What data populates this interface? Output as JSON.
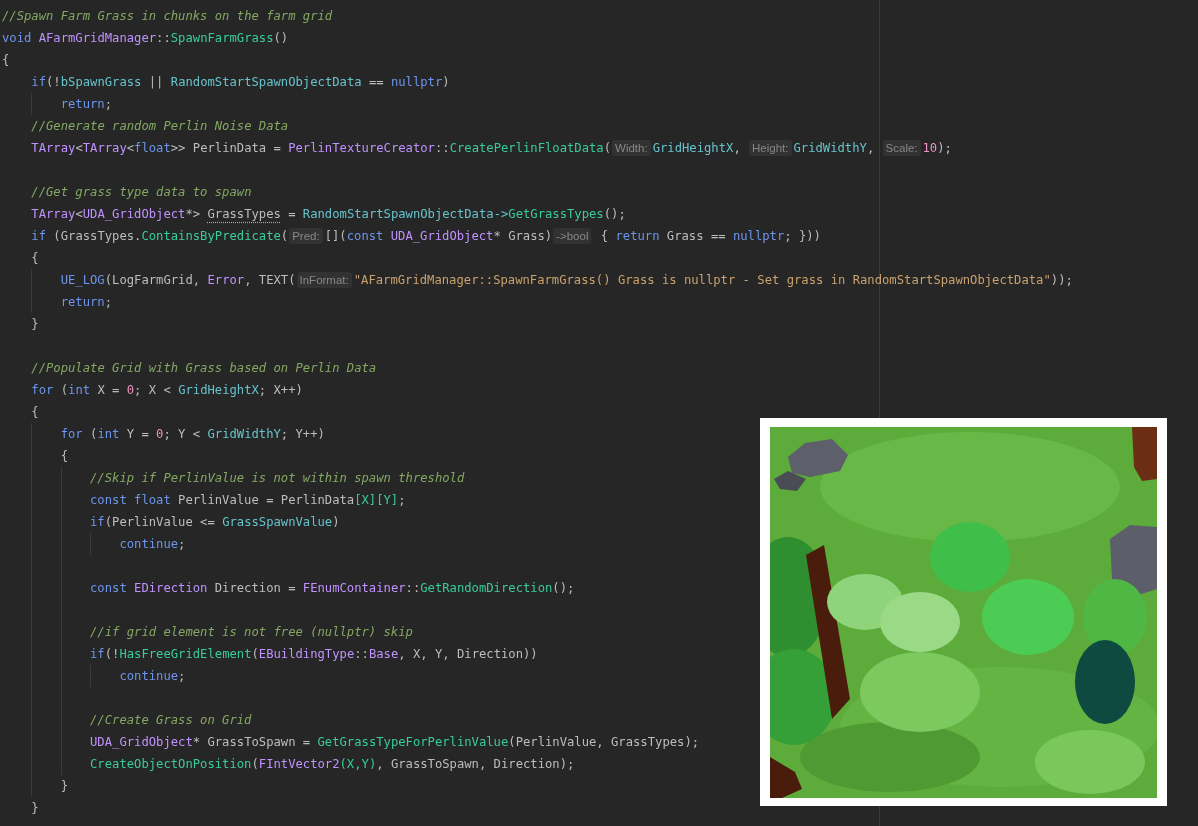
{
  "editor": {
    "lines": [
      {
        "kind": "code",
        "tokens": [
          {
            "text": "//Spawn Farm Grass in chunks on the farm grid",
            "kind": "comment"
          }
        ]
      },
      {
        "kind": "code",
        "tokens": [
          {
            "text": "void ",
            "kind": "keyword"
          },
          {
            "text": "AFarmGridManager",
            "kind": "type"
          },
          {
            "text": "::",
            "kind": "plain"
          },
          {
            "text": "SpawnFarmGrass",
            "kind": "function"
          },
          {
            "text": "()",
            "kind": "plain"
          }
        ]
      },
      {
        "kind": "code",
        "tokens": [
          {
            "text": "{",
            "kind": "plain"
          }
        ],
        "children": [
          {
            "kind": "code",
            "tokens": [
              {
                "text": "if",
                "kind": "keyword"
              },
              {
                "text": "(!",
                "kind": "plain"
              },
              {
                "text": "bSpawnGrass",
                "kind": "field"
              },
              {
                "text": " || ",
                "kind": "plain"
              },
              {
                "text": "RandomStartSpawnObjectData",
                "kind": "field"
              },
              {
                "text": " == ",
                "kind": "plain"
              },
              {
                "text": "nullptr",
                "kind": "keyword"
              },
              {
                "text": ")",
                "kind": "plain"
              }
            ],
            "children": [
              {
                "kind": "code",
                "tokens": [
                  {
                    "text": "return",
                    "kind": "keyword"
                  },
                  {
                    "text": ";",
                    "kind": "plain"
                  }
                ]
              }
            ]
          },
          {
            "kind": "code",
            "tokens": [
              {
                "text": "//Generate random Perlin Noise Data",
                "kind": "comment"
              }
            ]
          },
          {
            "kind": "code",
            "tokens": [
              {
                "text": "TArray",
                "kind": "type"
              },
              {
                "text": "<",
                "kind": "plain"
              },
              {
                "text": "TArray",
                "kind": "type"
              },
              {
                "text": "<",
                "kind": "plain"
              },
              {
                "text": "float",
                "kind": "keyword"
              },
              {
                "text": ">> PerlinData = ",
                "kind": "plain"
              },
              {
                "text": "PerlinTextureCreator",
                "kind": "type"
              },
              {
                "text": "::",
                "kind": "plain"
              },
              {
                "text": "CreatePerlinFloatData",
                "kind": "function"
              },
              {
                "text": "(",
                "kind": "plain"
              },
              {
                "text": "Width:",
                "kind": "hint"
              },
              {
                "text": "GridHeightX",
                "kind": "field"
              },
              {
                "text": ", ",
                "kind": "plain"
              },
              {
                "text": "Height:",
                "kind": "hint"
              },
              {
                "text": "GridWidthY",
                "kind": "field"
              },
              {
                "text": ", ",
                "kind": "plain"
              },
              {
                "text": "Scale:",
                "kind": "hint"
              },
              {
                "text": "10",
                "kind": "number"
              },
              {
                "text": ");",
                "kind": "plain"
              }
            ]
          },
          {
            "kind": "blank"
          },
          {
            "kind": "code",
            "tokens": [
              {
                "text": "//Get grass type data to spawn",
                "kind": "comment"
              }
            ]
          },
          {
            "kind": "code",
            "tokens": [
              {
                "text": "TArray",
                "kind": "type"
              },
              {
                "text": "<",
                "kind": "plain"
              },
              {
                "text": "UDA_GridObject",
                "kind": "type"
              },
              {
                "text": "*> ",
                "kind": "plain"
              },
              {
                "text": "GrassTypes",
                "kind": "flagged"
              },
              {
                "text": " = ",
                "kind": "plain"
              },
              {
                "text": "RandomStartSpawnObjectData->",
                "kind": "field"
              },
              {
                "text": "GetGrassTypes",
                "kind": "function"
              },
              {
                "text": "();",
                "kind": "plain"
              }
            ]
          },
          {
            "kind": "code",
            "tokens": [
              {
                "text": "if",
                "kind": "keyword"
              },
              {
                "text": " (GrassTypes.",
                "kind": "plain"
              },
              {
                "text": "ContainsByPredicate",
                "kind": "function"
              },
              {
                "text": "(",
                "kind": "plain"
              },
              {
                "text": "Pred:",
                "kind": "hint"
              },
              {
                "text": "[](",
                "kind": "plain"
              },
              {
                "text": "const ",
                "kind": "keyword"
              },
              {
                "text": "UDA_GridObject",
                "kind": "type"
              },
              {
                "text": "* Grass)",
                "kind": "plain"
              },
              {
                "text": "->bool",
                "kind": "hint"
              },
              {
                "text": " { ",
                "kind": "plain"
              },
              {
                "text": "return",
                "kind": "keyword"
              },
              {
                "text": " Grass == ",
                "kind": "plain"
              },
              {
                "text": "nullptr",
                "kind": "keyword"
              },
              {
                "text": "; }))",
                "kind": "plain"
              }
            ]
          },
          {
            "kind": "code",
            "tokens": [
              {
                "text": "{",
                "kind": "plain"
              }
            ],
            "children": [
              {
                "kind": "code",
                "tokens": [
                  {
                    "text": "UE_LOG",
                    "kind": "macro"
                  },
                  {
                    "text": "(LogFarmGrid, ",
                    "kind": "plain"
                  },
                  {
                    "text": "Error",
                    "kind": "type"
                  },
                  {
                    "text": ", TEXT(",
                    "kind": "plain"
                  },
                  {
                    "text": "InFormat:",
                    "kind": "hint"
                  },
                  {
                    "text": "\"AFarmGridManager::SpawnFarmGrass() Grass is nullptr - Set grass in RandomStartSpawnObjectData\"",
                    "kind": "string"
                  },
                  {
                    "text": "));",
                    "kind": "plain"
                  }
                ]
              },
              {
                "kind": "code",
                "tokens": [
                  {
                    "text": "return",
                    "kind": "keyword"
                  },
                  {
                    "text": ";",
                    "kind": "plain"
                  }
                ]
              }
            ]
          },
          {
            "kind": "code",
            "tokens": [
              {
                "text": "}",
                "kind": "plain"
              }
            ]
          },
          {
            "kind": "blank"
          },
          {
            "kind": "code",
            "tokens": [
              {
                "text": "//Populate Grid with Grass based on Perlin Data",
                "kind": "comment"
              }
            ]
          },
          {
            "kind": "code",
            "tokens": [
              {
                "text": "for",
                "kind": "keyword"
              },
              {
                "text": " (",
                "kind": "plain"
              },
              {
                "text": "int",
                "kind": "keyword"
              },
              {
                "text": " X = ",
                "kind": "plain"
              },
              {
                "text": "0",
                "kind": "number"
              },
              {
                "text": "; X < ",
                "kind": "plain"
              },
              {
                "text": "GridHeightX",
                "kind": "field"
              },
              {
                "text": "; X++)",
                "kind": "plain"
              }
            ]
          },
          {
            "kind": "code",
            "tokens": [
              {
                "text": "{",
                "kind": "plain"
              }
            ],
            "children": [
              {
                "kind": "code",
                "tokens": [
                  {
                    "text": "for",
                    "kind": "keyword"
                  },
                  {
                    "text": " (",
                    "kind": "plain"
                  },
                  {
                    "text": "int",
                    "kind": "keyword"
                  },
                  {
                    "text": " Y = ",
                    "kind": "plain"
                  },
                  {
                    "text": "0",
                    "kind": "number"
                  },
                  {
                    "text": "; Y < ",
                    "kind": "plain"
                  },
                  {
                    "text": "GridWidthY",
                    "kind": "field"
                  },
                  {
                    "text": "; Y++)",
                    "kind": "plain"
                  }
                ]
              },
              {
                "kind": "code",
                "tokens": [
                  {
                    "text": "{",
                    "kind": "plain"
                  }
                ],
                "children": [
                  {
                    "kind": "code",
                    "tokens": [
                      {
                        "text": "//Skip if PerlinValue is not within spawn threshold",
                        "kind": "comment"
                      }
                    ]
                  },
                  {
                    "kind": "code",
                    "tokens": [
                      {
                        "text": "const ",
                        "kind": "keyword"
                      },
                      {
                        "text": "float",
                        "kind": "keyword"
                      },
                      {
                        "text": " PerlinValue = PerlinData",
                        "kind": "plain"
                      },
                      {
                        "text": "[X][Y]",
                        "kind": "function"
                      },
                      {
                        "text": ";",
                        "kind": "plain"
                      }
                    ]
                  },
                  {
                    "kind": "code",
                    "tokens": [
                      {
                        "text": "if",
                        "kind": "keyword"
                      },
                      {
                        "text": "(PerlinValue <= ",
                        "kind": "plain"
                      },
                      {
                        "text": "GrassSpawnValue",
                        "kind": "field"
                      },
                      {
                        "text": ")",
                        "kind": "plain"
                      }
                    ],
                    "children": [
                      {
                        "kind": "code",
                        "tokens": [
                          {
                            "text": "continue",
                            "kind": "keyword"
                          },
                          {
                            "text": ";",
                            "kind": "plain"
                          }
                        ]
                      }
                    ]
                  },
                  {
                    "kind": "blank"
                  },
                  {
                    "kind": "code",
                    "tokens": [
                      {
                        "text": "const ",
                        "kind": "keyword"
                      },
                      {
                        "text": "EDirection",
                        "kind": "type"
                      },
                      {
                        "text": " Direction = ",
                        "kind": "plain"
                      },
                      {
                        "text": "FEnumContainer",
                        "kind": "type"
                      },
                      {
                        "text": "::",
                        "kind": "plain"
                      },
                      {
                        "text": "GetRandomDirection",
                        "kind": "function"
                      },
                      {
                        "text": "();",
                        "kind": "plain"
                      }
                    ]
                  },
                  {
                    "kind": "blank"
                  },
                  {
                    "kind": "code",
                    "tokens": [
                      {
                        "text": "//if grid element is not free (nullptr) skip",
                        "kind": "comment"
                      }
                    ]
                  },
                  {
                    "kind": "code",
                    "tokens": [
                      {
                        "text": "if",
                        "kind": "keyword"
                      },
                      {
                        "text": "(!",
                        "kind": "plain"
                      },
                      {
                        "text": "HasFreeGridElement",
                        "kind": "function"
                      },
                      {
                        "text": "(",
                        "kind": "plain"
                      },
                      {
                        "text": "EBuildingType",
                        "kind": "type"
                      },
                      {
                        "text": "::",
                        "kind": "plain"
                      },
                      {
                        "text": "Base",
                        "kind": "type"
                      },
                      {
                        "text": ", X, Y, Direction))",
                        "kind": "plain"
                      }
                    ],
                    "children": [
                      {
                        "kind": "code",
                        "tokens": [
                          {
                            "text": "continue",
                            "kind": "keyword"
                          },
                          {
                            "text": ";",
                            "kind": "plain"
                          }
                        ]
                      }
                    ]
                  },
                  {
                    "kind": "blank"
                  },
                  {
                    "kind": "code",
                    "tokens": [
                      {
                        "text": "//Create Grass on Grid",
                        "kind": "comment"
                      }
                    ]
                  },
                  {
                    "kind": "code",
                    "tokens": [
                      {
                        "text": "UDA_GridObject",
                        "kind": "type"
                      },
                      {
                        "text": "* GrassToSpawn = ",
                        "kind": "plain"
                      },
                      {
                        "text": "GetGrassTypeForPerlinValue",
                        "kind": "function"
                      },
                      {
                        "text": "(PerlinValue, GrassTypes);",
                        "kind": "plain"
                      }
                    ]
                  },
                  {
                    "kind": "code",
                    "tokens": [
                      {
                        "text": "CreateObjectOnPosition",
                        "kind": "function"
                      },
                      {
                        "text": "(",
                        "kind": "plain"
                      },
                      {
                        "text": "FIntVector2",
                        "kind": "type"
                      },
                      {
                        "text": "(X,Y)",
                        "kind": "function"
                      },
                      {
                        "text": ", GrassToSpawn, Direction);",
                        "kind": "plain"
                      }
                    ]
                  }
                ]
              },
              {
                "kind": "code",
                "tokens": [
                  {
                    "text": "}",
                    "kind": "plain"
                  }
                ]
              }
            ]
          },
          {
            "kind": "code",
            "tokens": [
              {
                "text": "}",
                "kind": "plain"
              }
            ]
          }
        ]
      }
    ]
  },
  "inset": {
    "kind": "photo"
  }
}
